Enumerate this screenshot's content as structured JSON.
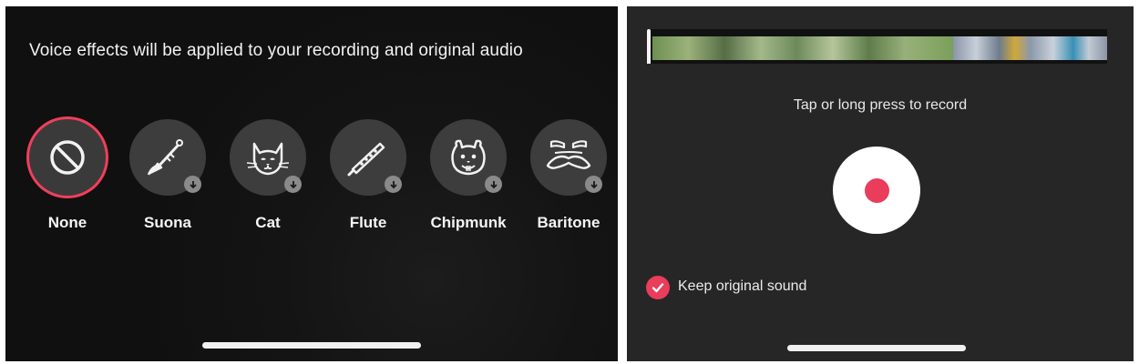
{
  "left": {
    "notice": "Voice effects will be applied to your recording and original audio",
    "effects": [
      {
        "label": "None",
        "icon": "no-effect-icon",
        "selected": true
      },
      {
        "label": "Suona",
        "icon": "suona-icon",
        "downloadable": true
      },
      {
        "label": "Cat",
        "icon": "cat-icon",
        "downloadable": true
      },
      {
        "label": "Flute",
        "icon": "flute-icon",
        "downloadable": true
      },
      {
        "label": "Chipmunk",
        "icon": "chipmunk-icon",
        "downloadable": true
      },
      {
        "label": "Baritone",
        "icon": "baritone-icon",
        "downloadable": true
      }
    ]
  },
  "right": {
    "hint": "Tap or long press to record",
    "keep_original_sound": "Keep original sound",
    "keep_original_checked": true
  },
  "colors": {
    "accent": "#ea3c5b",
    "panel_dark": "#101010",
    "panel_gray": "#262626",
    "effect_circle": "#3d3d3d"
  }
}
